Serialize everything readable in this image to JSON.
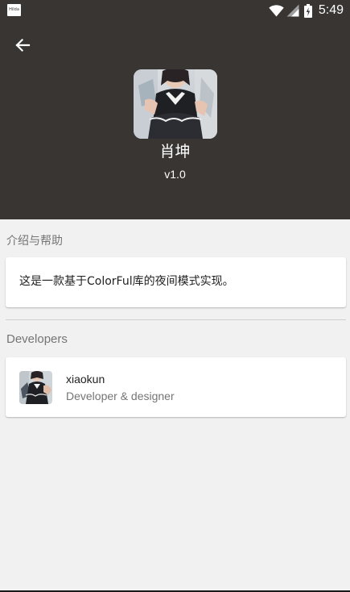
{
  "status_bar": {
    "notification_icon": "notification-thumbnail-icon",
    "notification_text": "Hilda",
    "time": "5:49",
    "icons": [
      "wifi-icon",
      "signal-icon",
      "battery-charging-icon"
    ]
  },
  "toolbar": {
    "back_icon": "arrow-left-icon"
  },
  "app": {
    "name": "肖坤",
    "version": "v1.0",
    "icon": "app-photo-icon"
  },
  "intro": {
    "title": "介绍与帮助",
    "text": "这是一款基于ColorFul库的夜间模式实现。"
  },
  "developers": {
    "title": "Developers",
    "items": [
      {
        "name": "xiaokun",
        "role": "Developer & designer",
        "avatar": "developer-avatar"
      }
    ]
  },
  "colors": {
    "header_bg": "#383533",
    "page_bg": "#f1f1f1",
    "card_bg": "#ffffff",
    "secondary_text": "#757575"
  }
}
